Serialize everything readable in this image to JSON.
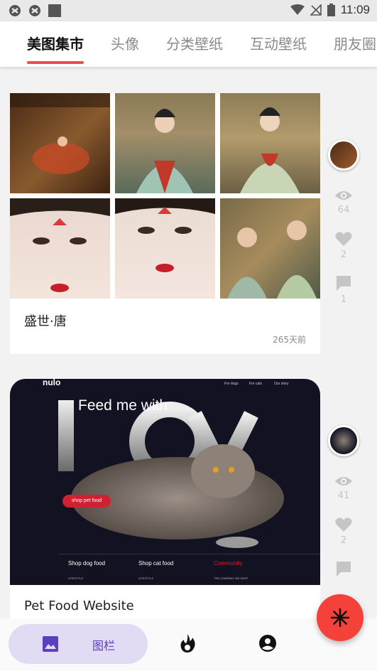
{
  "status_bar": {
    "time": "11:09"
  },
  "tabs": [
    {
      "label": "美图集市",
      "active": true
    },
    {
      "label": "头像",
      "active": false
    },
    {
      "label": "分类壁纸",
      "active": false
    },
    {
      "label": "互动壁纸",
      "active": false
    },
    {
      "label": "朋友圈",
      "active": false
    }
  ],
  "posts": [
    {
      "title": "盛世·唐",
      "time": "265天前",
      "views": "64",
      "likes": "2",
      "comments": "1"
    },
    {
      "title": "Pet Food Website",
      "views": "41",
      "likes": "2",
      "image_text": {
        "brand": "nulo",
        "nav": [
          "For dogs",
          "For cats",
          "Our story"
        ],
        "headline": "Feed me with",
        "big_word": "love",
        "cta": "shop pet food",
        "footer_links": [
          "Shop dog food",
          "Shop cat food",
          "Community"
        ],
        "footer_sub": [
          "LIFESTYLE",
          "LIFESTYLE",
          "THE COMPANY WE KEEP"
        ]
      }
    }
  ],
  "bottom_nav": {
    "gallery_label": "图栏",
    "icons": [
      "image-icon",
      "fire-icon",
      "account-icon"
    ]
  },
  "fab": {
    "icon": "snowflake-icon"
  },
  "colors": {
    "accent": "#ef4d4d",
    "fab": "#f4423a",
    "nav_pill": "#e1dbf3",
    "nav_text": "#5a3fc0"
  }
}
